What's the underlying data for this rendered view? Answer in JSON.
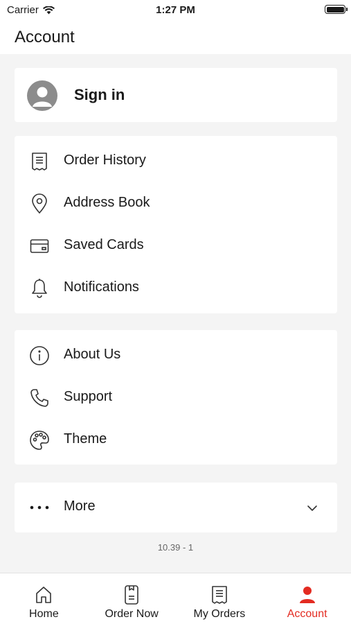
{
  "status_bar": {
    "carrier": "Carrier",
    "time": "1:27 PM"
  },
  "header": {
    "title": "Account"
  },
  "signin": {
    "label": "Sign in"
  },
  "menu_primary": [
    {
      "label": "Order History",
      "icon": "receipt-icon"
    },
    {
      "label": "Address Book",
      "icon": "location-pin-icon"
    },
    {
      "label": "Saved Cards",
      "icon": "credit-card-icon"
    },
    {
      "label": "Notifications",
      "icon": "bell-icon"
    }
  ],
  "menu_secondary": [
    {
      "label": "About Us",
      "icon": "info-icon"
    },
    {
      "label": "Support",
      "icon": "phone-icon"
    },
    {
      "label": "Theme",
      "icon": "palette-icon"
    }
  ],
  "more": {
    "label": "More",
    "icon": "ellipsis-icon"
  },
  "version": "10.39 - 1",
  "tabs": [
    {
      "label": "Home",
      "icon": "home-icon",
      "active": false
    },
    {
      "label": "Order Now",
      "icon": "order-icon",
      "active": false
    },
    {
      "label": "My Orders",
      "icon": "receipt-icon",
      "active": false
    },
    {
      "label": "Account",
      "icon": "person-icon",
      "active": true
    }
  ],
  "colors": {
    "accent": "#e32b21",
    "background": "#f4f4f4",
    "card": "#ffffff",
    "avatar": "#8c8c8c"
  }
}
